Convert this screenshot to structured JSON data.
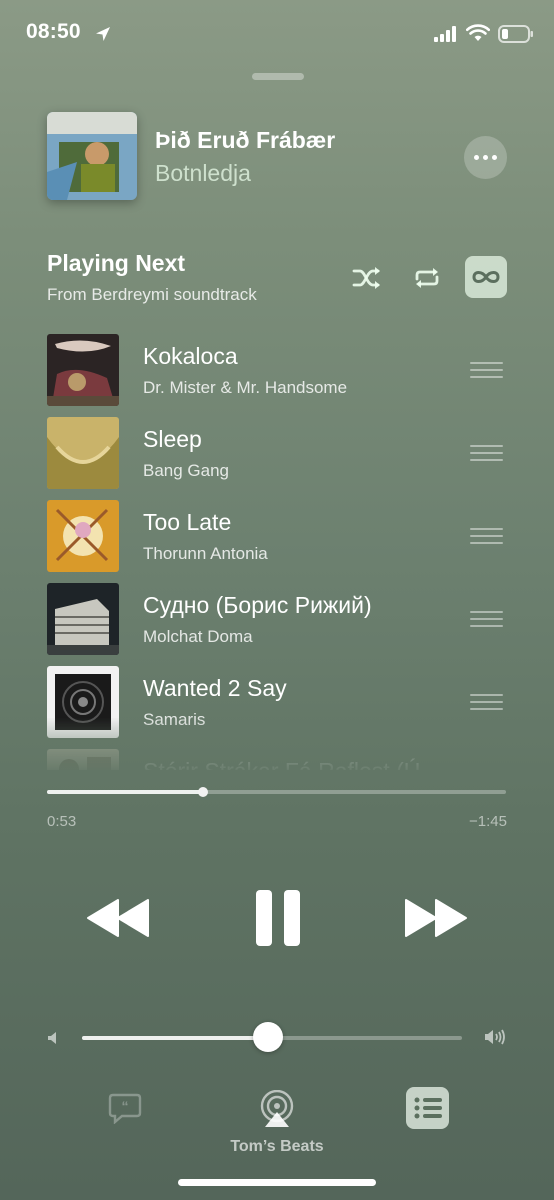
{
  "status_bar": {
    "time": "08:50"
  },
  "now_playing": {
    "title": "Þið Eruð Frábær",
    "artist": "Botnledja"
  },
  "playing_next": {
    "title": "Playing Next",
    "source": "From Berdreymi soundtrack"
  },
  "queue": [
    {
      "title": "Kokaloca",
      "artist": "Dr. Mister & Mr. Handsome"
    },
    {
      "title": "Sleep",
      "artist": "Bang Gang"
    },
    {
      "title": "Too Late",
      "artist": "Thorunn Antonia"
    },
    {
      "title": "Судно (Борис Рижий)",
      "artist": "Molchat Doma"
    },
    {
      "title": "Wanted 2 Say",
      "artist": "Samaris"
    },
    {
      "title": "Stórir Strákar Fá Raflost (Ú",
      "artist": ""
    }
  ],
  "playback": {
    "elapsed": "0:53",
    "remaining": "−1:45",
    "progress": 0.34,
    "volume": 0.49
  },
  "bottom_bar": {
    "device": "Tom’s Beats"
  },
  "colors": {
    "accent_tile": "#dfeedf",
    "background": "#6d8170"
  }
}
